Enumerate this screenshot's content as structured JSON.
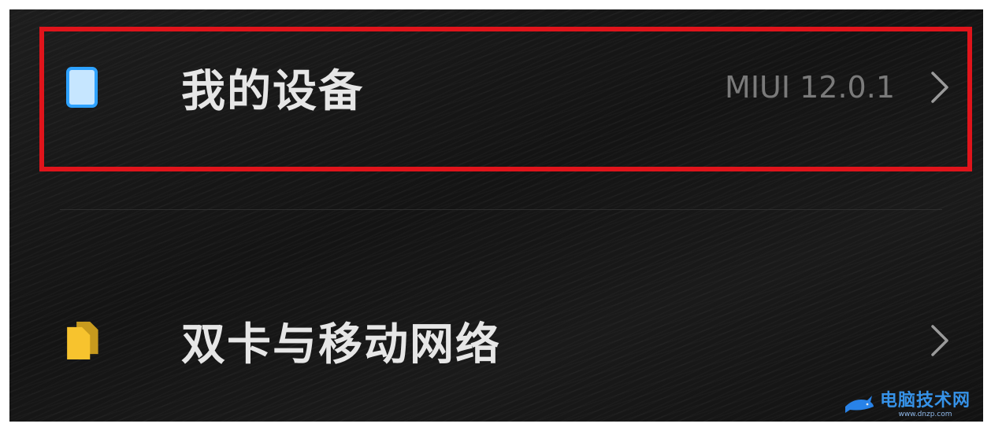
{
  "settings": {
    "items": [
      {
        "icon": "phone-device-icon",
        "label": "我的设备",
        "value": "MIUI 12.0.1",
        "chevron": "chevron-right-icon"
      },
      {
        "icon": "sim-cards-icon",
        "label": "双卡与移动网络",
        "value": "",
        "chevron": "chevron-right-icon"
      }
    ]
  },
  "highlight": {
    "color": "#e0141b"
  },
  "colors": {
    "background": "#161616",
    "label": "#e6e6e6",
    "value": "#7a7a7a",
    "device_icon": "#2ea2ff",
    "sim_icon": "#f7c32e"
  },
  "watermark": {
    "title": "电脑技术网",
    "url": "www.dnzp.com"
  }
}
